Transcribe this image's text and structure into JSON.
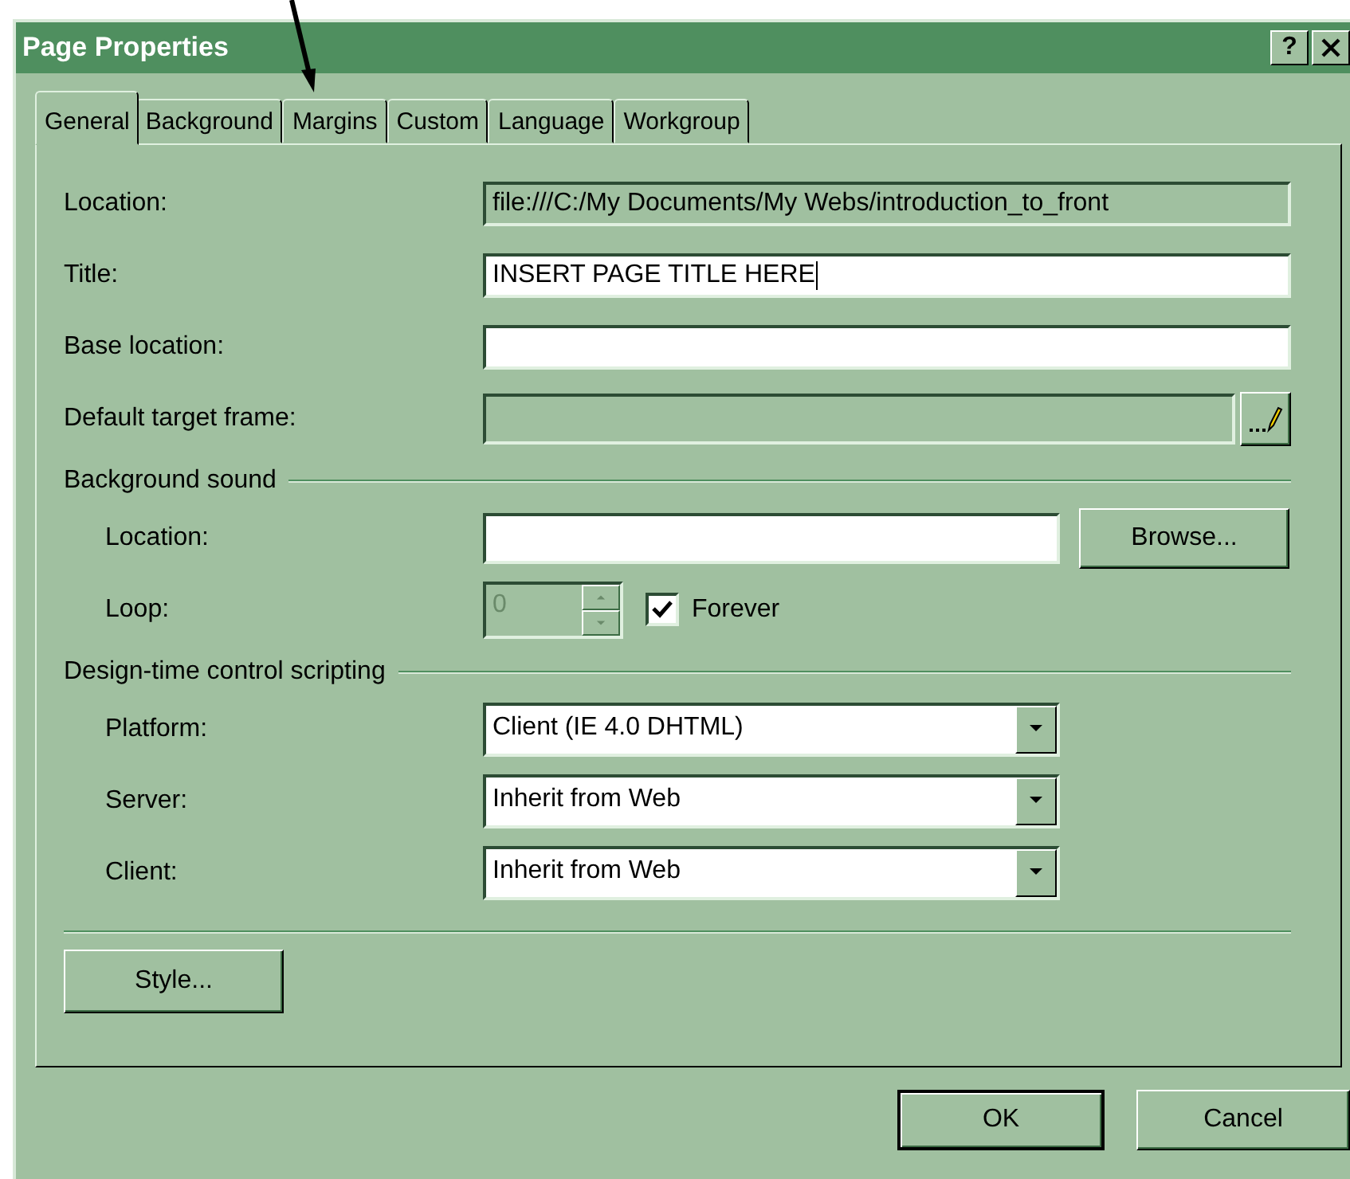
{
  "window": {
    "title": "Page Properties",
    "help": "?"
  },
  "tabs": [
    {
      "label": "General",
      "selected": true
    },
    {
      "label": "Background",
      "selected": false
    },
    {
      "label": "Margins",
      "selected": false
    },
    {
      "label": "Custom",
      "selected": false
    },
    {
      "label": "Language",
      "selected": false
    },
    {
      "label": "Workgroup",
      "selected": false
    }
  ],
  "rows": [
    {
      "kind": "field",
      "label": "Location:",
      "value": "file:///C:/My Documents/My Webs/introduction_to_front",
      "readonly": true
    },
    {
      "kind": "field",
      "label": "Title:",
      "value": "INSERT PAGE TITLE HERE",
      "readonly": false
    },
    {
      "kind": "field",
      "label": "Base location:",
      "readonly": false
    },
    {
      "kind": "picker",
      "label": "Default target frame:",
      "disabled": true
    }
  ],
  "background_sound": {
    "title": "Background sound",
    "location": {
      "label": "Location:",
      "button": "Browse..."
    },
    "loop": {
      "label": "Loop:",
      "value": "0",
      "disabled": true,
      "checkbox": {
        "label": "Forever",
        "checked": true
      }
    }
  },
  "scripting": {
    "title": "Design-time control scripting",
    "selects": [
      {
        "label": "Platform:",
        "value": "Client (IE 4.0 DHTML)"
      },
      {
        "label": "Server:",
        "value": "Inherit from Web"
      },
      {
        "label": "Client:",
        "value": "Inherit from Web"
      }
    ]
  },
  "style_button": "Style...",
  "buttons": [
    {
      "label": "OK",
      "default": true
    },
    {
      "label": "Cancel",
      "default": false
    }
  ]
}
